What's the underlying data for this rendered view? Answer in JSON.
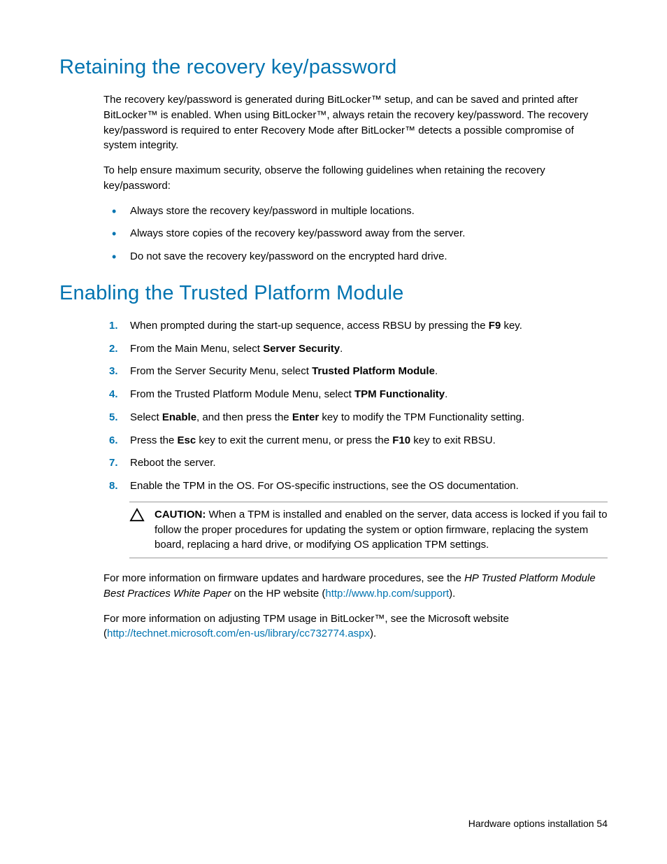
{
  "section1": {
    "title": "Retaining the recovery key/password",
    "para1": "The recovery key/password is generated during BitLocker™ setup, and can be saved and printed after BitLocker™ is enabled. When using BitLocker™, always retain the recovery key/password. The recovery key/password is required to enter Recovery Mode after BitLocker™ detects a possible compromise of system integrity.",
    "para2": "To help ensure maximum security, observe the following guidelines when retaining the recovery key/password:",
    "bullets": [
      "Always store the recovery key/password in multiple locations.",
      "Always store copies of the recovery key/password away from the server.",
      "Do not save the recovery key/password on the encrypted hard drive."
    ]
  },
  "section2": {
    "title": "Enabling the Trusted Platform Module",
    "step1_a": "When prompted during the start-up sequence, access RBSU by pressing the ",
    "step1_b": "F9",
    "step1_c": " key.",
    "step2_a": "From the Main Menu, select ",
    "step2_b": "Server Security",
    "step2_c": ".",
    "step3_a": "From the Server Security Menu, select ",
    "step3_b": "Trusted Platform Module",
    "step3_c": ".",
    "step4_a": "From the Trusted Platform Module Menu, select ",
    "step4_b": "TPM Functionality",
    "step4_c": ".",
    "step5_a": "Select ",
    "step5_b": "Enable",
    "step5_c": ", and then press the ",
    "step5_d": "Enter",
    "step5_e": " key to modify the TPM Functionality setting.",
    "step6_a": "Press the ",
    "step6_b": "Esc",
    "step6_c": " key to exit the current menu, or press the ",
    "step6_d": "F10",
    "step6_e": " key to exit RBSU.",
    "step7": "Reboot the server.",
    "step8": "Enable the TPM in the OS. For OS-specific instructions, see the OS documentation.",
    "caution_label": "CAUTION:",
    "caution_text": "   When a TPM is installed and enabled on the server, data access is locked if you fail to follow the proper procedures for updating the system or option firmware, replacing the system board, replacing a hard drive, or modifying OS application TPM settings.",
    "more1_a": "For more information on firmware updates and hardware procedures, see the ",
    "more1_b": "HP Trusted Platform Module Best Practices White Paper",
    "more1_c": " on the HP website (",
    "more1_link": "http://www.hp.com/support",
    "more1_d": ").",
    "more2_a": "For more information on adjusting TPM usage in BitLocker™, see the Microsoft website (",
    "more2_link": "http://technet.microsoft.com/en-us/library/cc732774.aspx",
    "more2_b": ")."
  },
  "footer": {
    "text": "Hardware options installation   54"
  }
}
